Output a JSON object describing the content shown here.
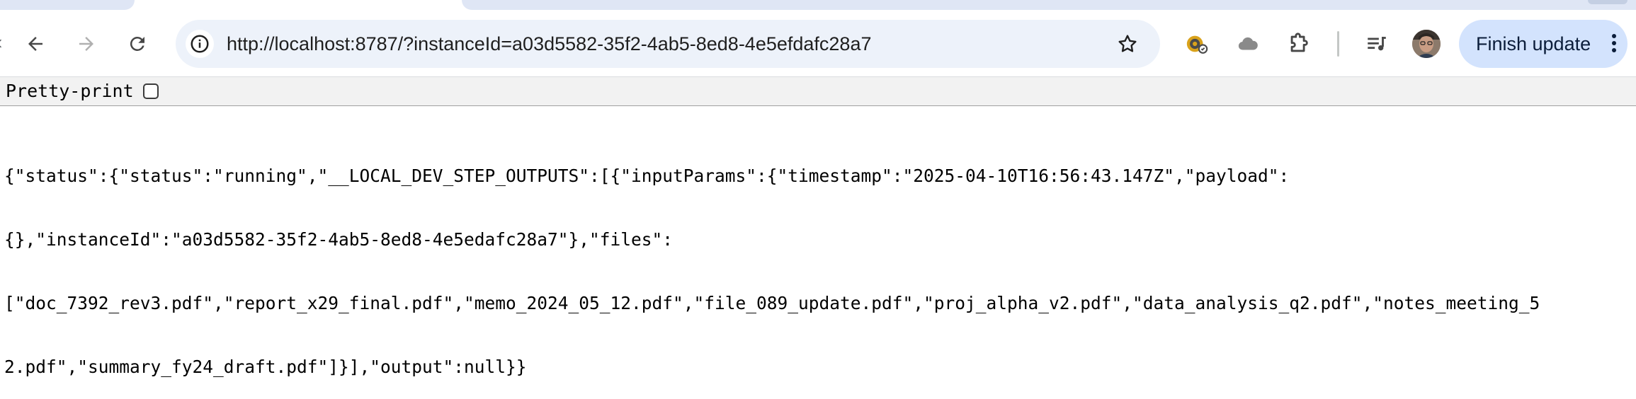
{
  "browser": {
    "url": "http://localhost:8787/?instanceId=a03d5582-35f2-4ab5-8ed8-4e5efdafc28a7",
    "finish_update_label": "Finish update",
    "icons": {
      "back": "arrow-left-icon",
      "forward": "arrow-right-icon",
      "reload": "reload-icon",
      "site_info": "info-icon",
      "bookmark": "star-icon",
      "extension_1": "key-extension-icon",
      "extension_2": "cloud-icon",
      "extensions": "puzzle-icon",
      "media": "playlist-icon",
      "menu": "kebab-menu-icon"
    }
  },
  "viewer": {
    "pretty_print_label": "Pretty-print",
    "pretty_print_checked": false
  },
  "json_lines": [
    "{\"status\":{\"status\":\"running\",\"__LOCAL_DEV_STEP_OUTPUTS\":[{\"inputParams\":{\"timestamp\":\"2025-04-10T16:56:43.147Z\",\"payload\":",
    "{},\"instanceId\":\"a03d5582-35f2-4ab5-8ed8-4e5edafc28a7\"},\"files\":",
    "[\"doc_7392_rev3.pdf\",\"report_x29_final.pdf\",\"memo_2024_05_12.pdf\",\"file_089_update.pdf\",\"proj_alpha_v2.pdf\",\"data_analysis_q2.pdf\",\"notes_meeting_5",
    "2.pdf\",\"summary_fy24_draft.pdf\"]}],\"output\":null}}"
  ]
}
